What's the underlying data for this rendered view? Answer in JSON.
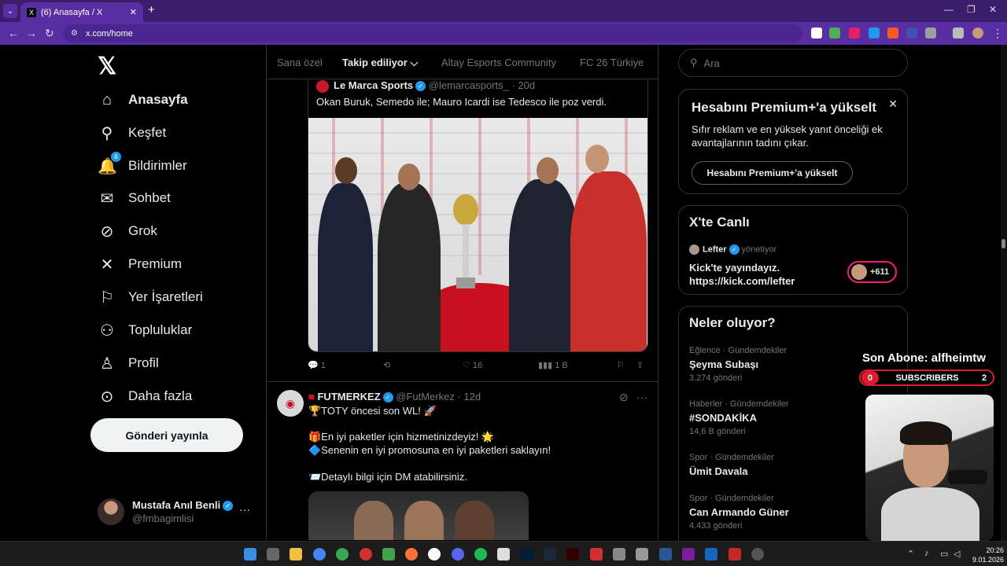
{
  "browser": {
    "tab_title": "(6) Anasayfa / X",
    "url": "x.com/home",
    "new_tab": "+",
    "close": "✕"
  },
  "nav": {
    "logo": "𝕏",
    "items": [
      {
        "label": "Anasayfa",
        "icon": "home-icon",
        "glyph": "⌂"
      },
      {
        "label": "Keşfet",
        "icon": "search-icon",
        "glyph": "⚲"
      },
      {
        "label": "Bildirimler",
        "icon": "bell-icon",
        "glyph": "🔔"
      },
      {
        "label": "Sohbet",
        "icon": "mail-icon",
        "glyph": "✉"
      },
      {
        "label": "Grok",
        "icon": "grok-icon",
        "glyph": "⊘"
      },
      {
        "label": "Premium",
        "icon": "x-premium-icon",
        "glyph": "✕"
      },
      {
        "label": "Yer İşaretleri",
        "icon": "bookmark-icon",
        "glyph": "⚐"
      },
      {
        "label": "Topluluklar",
        "icon": "communities-icon",
        "glyph": "⚇"
      },
      {
        "label": "Profil",
        "icon": "person-icon",
        "glyph": "♙"
      },
      {
        "label": "Daha fazla",
        "icon": "more-circle-icon",
        "glyph": "⊙"
      }
    ],
    "notif_badge": "6",
    "post_button": "Gönderi yayınla",
    "profile": {
      "name": "Mustafa Anıl Benli",
      "handle": "@fmbagimlisi",
      "more": "···"
    }
  },
  "timeline": {
    "tabs": [
      "Sana özel",
      "Takip ediliyor",
      "Altay Esports Community",
      "FC 26 Türkiye"
    ],
    "active_tab_caret": "⌵",
    "quote": {
      "name": "Le Marca Sports",
      "handle": "@lemarcasports_ · 20d",
      "text": "Okan Buruk, Semedo ile; Mauro Icardi ise Tedesco ile poz verdi."
    },
    "actions": {
      "replies": "1",
      "likes": "16",
      "views": "1 B"
    },
    "post2": {
      "name": "FUTMERKEZ",
      "handle": "@FutMerkez · 12d",
      "more": "···",
      "lines": [
        "🏆TOTY öncesi son WL! 🚀",
        "🎁En iyi paketler için hizmetinizdeyiz! 🌟",
        "🔷Senenin en iyi promosuna en iyi paketleri saklayın!",
        "📨Detaylı bilgi için DM atabilirsiniz."
      ]
    }
  },
  "right": {
    "search_placeholder": "Ara",
    "premium": {
      "title": "Hesabını Premium+'a yükselt",
      "text": "Sıfır reklam ve en yüksek yanıt önceliği ek avantajlarının tadını çıkar.",
      "button": "Hesabını Premium+'a yükselt",
      "close": "✕"
    },
    "live": {
      "title": "X'te Canlı",
      "host": "Lefter",
      "host_role": "yönetiyor",
      "line1": "Kick'te yayındayız.",
      "line2": "https://kick.com/lefter",
      "count": "+611"
    },
    "trends": {
      "title": "Neler oluyor?",
      "items": [
        {
          "category": "Eğlence · Gündemdekiler",
          "topic": "Şeyma Subaşı",
          "count": "3.274 gönderi"
        },
        {
          "category": "Haberler · Gündemdekiler",
          "topic": "#SONDAKİKA",
          "count": "14,6 B gönderi"
        },
        {
          "category": "Spor · Gündemdekiler",
          "topic": "Ümit Davala",
          "count": ""
        },
        {
          "category": "Spor · Gündemdekiler",
          "topic": "Can Armando Güner",
          "count": "4.433 gönderi"
        }
      ]
    }
  },
  "overlay": {
    "sub_label": "Son Abone: alfheimtw",
    "sub_left": "0",
    "sub_word": "SUBSCRIBERS",
    "sub_right": "2"
  },
  "taskbar": {
    "time": "20:26",
    "date": "9.01.2026"
  }
}
